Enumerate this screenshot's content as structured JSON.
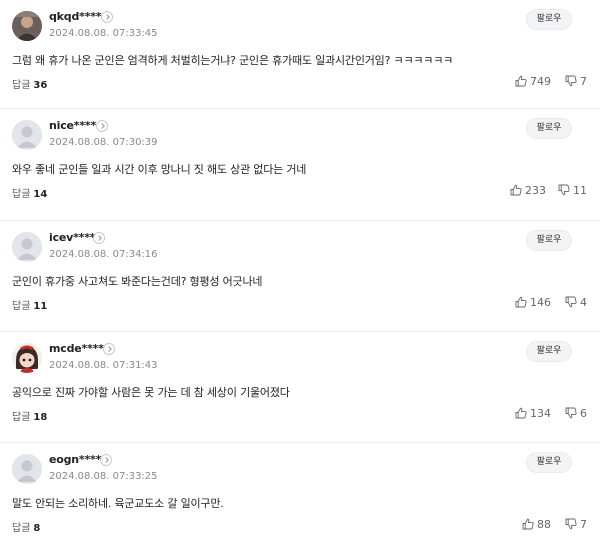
{
  "follow_label": "팔로우",
  "reply_label": "답글",
  "comments": [
    {
      "nick": "qkqd****",
      "time": "2024.08.08. 07:33:45",
      "text": "그럼 왜 휴가 나온 군인은 엄격하게 처벌히는거냐? 군인은 휴가때도 일과시간인거임? ㅋㅋㅋㅋㅋㅋ",
      "replies": "36",
      "likes": "749",
      "dislikes": "7",
      "avatar": "photo"
    },
    {
      "nick": "nice****",
      "time": "2024.08.08. 07:30:39",
      "text": "와우 좋네 군인들 일과 시간 이후 망나니 짓 해도 상관 없다는 거네",
      "replies": "14",
      "likes": "233",
      "dislikes": "11",
      "avatar": "default"
    },
    {
      "nick": "icev****",
      "time": "2024.08.08. 07:34:16",
      "text": "군인이 휴가중 사고쳐도 봐준다는건데? 형평성 어긋나네",
      "replies": "11",
      "likes": "146",
      "dislikes": "4",
      "avatar": "default"
    },
    {
      "nick": "mcde****",
      "time": "2024.08.08. 07:31:43",
      "text": "공익으로 진짜 가야할 사람은 못 가는 데 참 세상이 기울어졌다",
      "replies": "18",
      "likes": "134",
      "dislikes": "6",
      "avatar": "cartoon"
    },
    {
      "nick": "eogn****",
      "time": "2024.08.08. 07:33:25",
      "text": "말도 안되는 소리하네. 육군교도소 갈 일이구만.",
      "replies": "8",
      "likes": "88",
      "dislikes": "7",
      "avatar": "default"
    }
  ],
  "icons": {
    "like": "thumbs-up-icon",
    "dislike": "thumbs-down-icon",
    "badge": "chevron-right-icon"
  }
}
